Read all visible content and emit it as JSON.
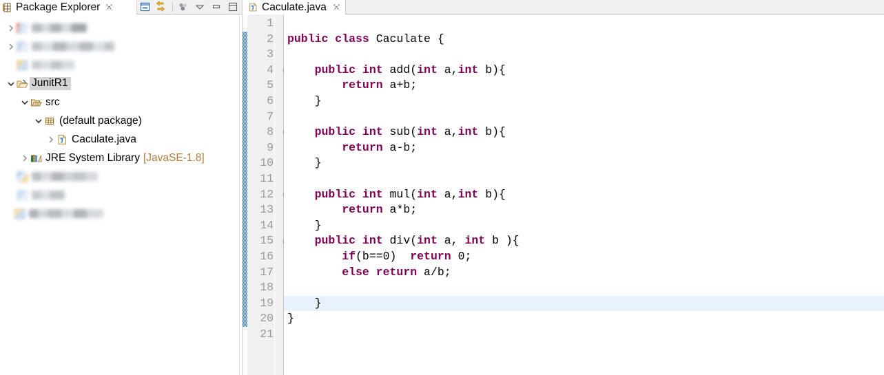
{
  "package_explorer": {
    "title": "Package Explorer",
    "close_label": "⨯",
    "view_icon": "package-explorer-icon",
    "toolbar": [
      {
        "name": "collapse-all-icon",
        "label": "Collapse All"
      },
      {
        "name": "link-with-editor-icon",
        "label": "Link with Editor"
      },
      {
        "name": "separator",
        "label": ""
      },
      {
        "name": "view-menu-icon",
        "label": "View Menu"
      },
      {
        "name": "chevron-down-icon",
        "label": "Minimize Chevron"
      },
      {
        "name": "minimize-icon",
        "label": "Minimize"
      },
      {
        "name": "maximize-icon",
        "label": "Maximize"
      }
    ],
    "tree": [
      {
        "label": "",
        "redacted": true,
        "indent": 0,
        "twisty": "collapsed",
        "icon": "project-icon",
        "selected": false
      },
      {
        "label": "",
        "redacted": true,
        "indent": 0,
        "twisty": "collapsed",
        "icon": "project-icon",
        "selected": false
      },
      {
        "label": "",
        "redacted": true,
        "indent": 0,
        "twisty": "none",
        "icon": "project-icon",
        "selected": false
      },
      {
        "label": "JunitR1",
        "redacted": false,
        "indent": 0,
        "twisty": "expanded",
        "icon": "open-project-icon",
        "selected": true
      },
      {
        "label": "src",
        "redacted": false,
        "indent": 1,
        "twisty": "expanded",
        "icon": "source-folder-icon",
        "selected": false
      },
      {
        "label": "(default package)",
        "redacted": false,
        "indent": 2,
        "twisty": "expanded",
        "icon": "package-icon",
        "selected": false
      },
      {
        "label": "Caculate.java",
        "redacted": false,
        "indent": 3,
        "twisty": "collapsed",
        "icon": "java-file-icon",
        "selected": false
      },
      {
        "label": "JRE System Library",
        "suffix": "[JavaSE-1.8]",
        "redacted": false,
        "indent": 1,
        "twisty": "collapsed",
        "icon": "jre-library-icon",
        "selected": false
      },
      {
        "label": "",
        "redacted": true,
        "indent": 0,
        "twisty": "none",
        "icon": "project-icon",
        "selected": false
      },
      {
        "label": "",
        "redacted": true,
        "indent": 0,
        "twisty": "none",
        "icon": "project-icon",
        "selected": false
      },
      {
        "label": "",
        "redacted": true,
        "indent": 0,
        "twisty": "none",
        "icon": "project-icon",
        "selected": false
      }
    ]
  },
  "editor": {
    "tab": {
      "label": "Caculate.java",
      "icon": "java-file-icon",
      "close_label": "⨯",
      "active": true
    },
    "current_line": 19,
    "change_bar": {
      "from_line": 2,
      "to_line": 20,
      "color": "#1f6fc4"
    },
    "colors": {
      "keyword": "#7f0055",
      "plain": "#000000",
      "line_number": "#9a9a9a",
      "gutter_bg": "#f0f0f0",
      "current_line_bg": "#e8f2fd",
      "jre_suffix": "#b07b38"
    },
    "lines": [
      {
        "n": 1,
        "fold": false,
        "tokens": []
      },
      {
        "n": 2,
        "fold": false,
        "tokens": [
          {
            "t": "kw",
            "v": "public class "
          },
          {
            "t": "plain",
            "v": "Caculate {"
          }
        ]
      },
      {
        "n": 3,
        "fold": false,
        "tokens": []
      },
      {
        "n": 4,
        "fold": true,
        "tokens": [
          {
            "t": "plain",
            "v": "    "
          },
          {
            "t": "kw",
            "v": "public int "
          },
          {
            "t": "plain",
            "v": "add("
          },
          {
            "t": "kw",
            "v": "int"
          },
          {
            "t": "plain",
            "v": " a,"
          },
          {
            "t": "kw",
            "v": "int"
          },
          {
            "t": "plain",
            "v": " b){"
          }
        ]
      },
      {
        "n": 5,
        "fold": false,
        "tokens": [
          {
            "t": "plain",
            "v": "        "
          },
          {
            "t": "kw",
            "v": "return"
          },
          {
            "t": "plain",
            "v": " a+b;"
          }
        ]
      },
      {
        "n": 6,
        "fold": false,
        "tokens": [
          {
            "t": "plain",
            "v": "    }"
          }
        ]
      },
      {
        "n": 7,
        "fold": false,
        "tokens": []
      },
      {
        "n": 8,
        "fold": true,
        "tokens": [
          {
            "t": "plain",
            "v": "    "
          },
          {
            "t": "kw",
            "v": "public int "
          },
          {
            "t": "plain",
            "v": "sub("
          },
          {
            "t": "kw",
            "v": "int"
          },
          {
            "t": "plain",
            "v": " a,"
          },
          {
            "t": "kw",
            "v": "int"
          },
          {
            "t": "plain",
            "v": " b){"
          }
        ]
      },
      {
        "n": 9,
        "fold": false,
        "tokens": [
          {
            "t": "plain",
            "v": "        "
          },
          {
            "t": "kw",
            "v": "return"
          },
          {
            "t": "plain",
            "v": " a-b;"
          }
        ]
      },
      {
        "n": 10,
        "fold": false,
        "tokens": [
          {
            "t": "plain",
            "v": "    }"
          }
        ]
      },
      {
        "n": 11,
        "fold": false,
        "tokens": []
      },
      {
        "n": 12,
        "fold": true,
        "tokens": [
          {
            "t": "plain",
            "v": "    "
          },
          {
            "t": "kw",
            "v": "public int "
          },
          {
            "t": "plain",
            "v": "mul("
          },
          {
            "t": "kw",
            "v": "int"
          },
          {
            "t": "plain",
            "v": " a,"
          },
          {
            "t": "kw",
            "v": "int"
          },
          {
            "t": "plain",
            "v": " b){"
          }
        ]
      },
      {
        "n": 13,
        "fold": false,
        "tokens": [
          {
            "t": "plain",
            "v": "        "
          },
          {
            "t": "kw",
            "v": "return"
          },
          {
            "t": "plain",
            "v": " a*b;"
          }
        ]
      },
      {
        "n": 14,
        "fold": false,
        "tokens": [
          {
            "t": "plain",
            "v": "    }"
          }
        ]
      },
      {
        "n": 15,
        "fold": true,
        "tokens": [
          {
            "t": "plain",
            "v": "    "
          },
          {
            "t": "kw",
            "v": "public int "
          },
          {
            "t": "plain",
            "v": "div("
          },
          {
            "t": "kw",
            "v": "int"
          },
          {
            "t": "plain",
            "v": " a, "
          },
          {
            "t": "kw",
            "v": "int"
          },
          {
            "t": "plain",
            "v": " b ){"
          }
        ]
      },
      {
        "n": 16,
        "fold": false,
        "tokens": [
          {
            "t": "plain",
            "v": "        "
          },
          {
            "t": "kw",
            "v": "if"
          },
          {
            "t": "plain",
            "v": "(b==0)  "
          },
          {
            "t": "kw",
            "v": "return"
          },
          {
            "t": "plain",
            "v": " 0;"
          }
        ]
      },
      {
        "n": 17,
        "fold": false,
        "tokens": [
          {
            "t": "plain",
            "v": "        "
          },
          {
            "t": "kw",
            "v": "else return"
          },
          {
            "t": "plain",
            "v": " a/b;"
          }
        ]
      },
      {
        "n": 18,
        "fold": false,
        "tokens": []
      },
      {
        "n": 19,
        "fold": false,
        "tokens": [
          {
            "t": "plain",
            "v": "    }"
          }
        ]
      },
      {
        "n": 20,
        "fold": false,
        "tokens": [
          {
            "t": "plain",
            "v": "}"
          }
        ]
      },
      {
        "n": 21,
        "fold": false,
        "tokens": []
      }
    ]
  }
}
